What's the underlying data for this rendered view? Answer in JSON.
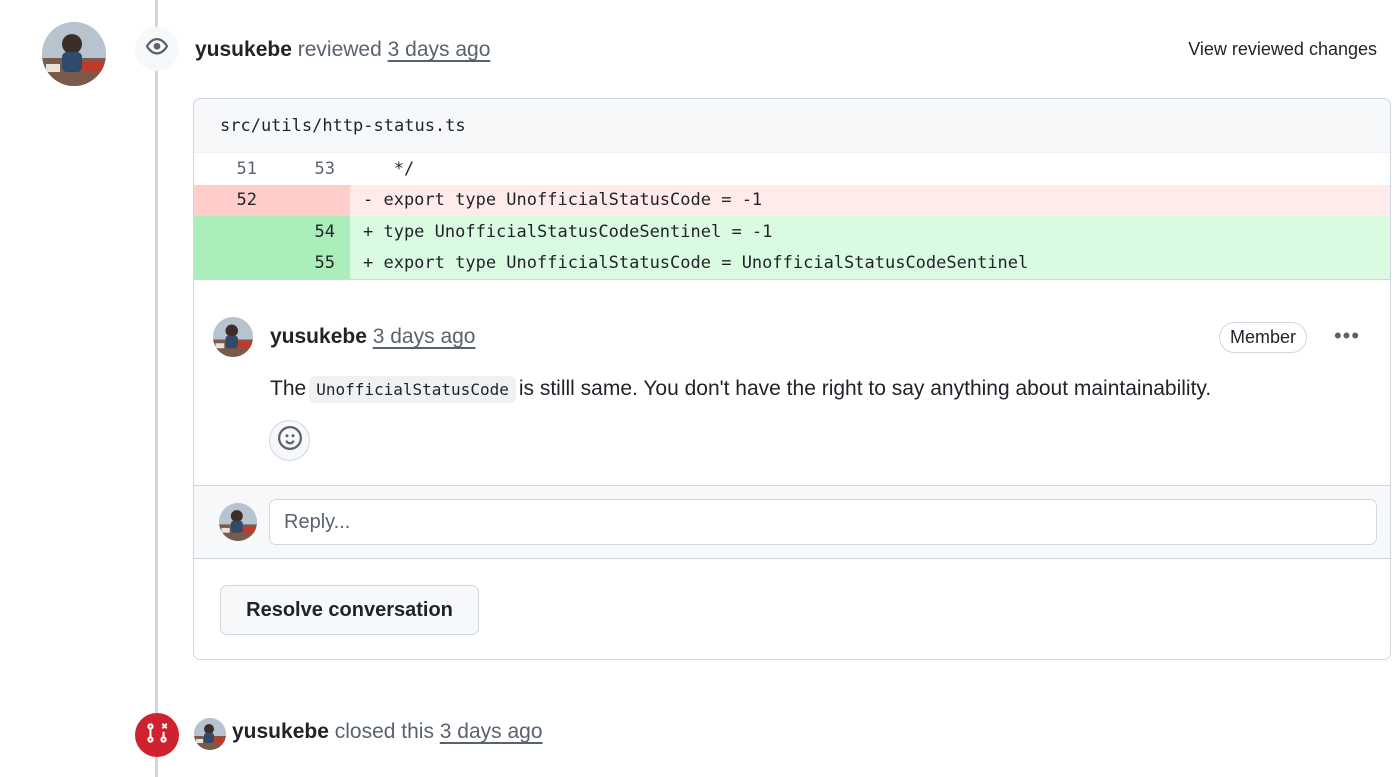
{
  "review": {
    "author": "yusukebe",
    "action": "reviewed",
    "time": "3 days ago",
    "view_changes_label": "View reviewed changes"
  },
  "diff": {
    "file_path": "src/utils/http-status.ts",
    "lines": [
      {
        "type": "ctx",
        "old": "51",
        "new": "53",
        "code": "   */"
      },
      {
        "type": "del",
        "old": "52",
        "new": "",
        "code": "- export type UnofficialStatusCode = -1"
      },
      {
        "type": "add",
        "old": "",
        "new": "54",
        "code": "+ type UnofficialStatusCodeSentinel = -1"
      },
      {
        "type": "add",
        "old": "",
        "new": "55",
        "code": "+ export type UnofficialStatusCode = UnofficialStatusCodeSentinel"
      }
    ]
  },
  "comment": {
    "author": "yusukebe",
    "time": "3 days ago",
    "badge": "Member",
    "menu_glyph": "•••",
    "body_before": "The",
    "body_code": "UnofficialStatusCode",
    "body_after": "is stilll same. You don't have the right to say anything about maintainability."
  },
  "reply": {
    "placeholder": "Reply..."
  },
  "resolve_label": "Resolve conversation",
  "closed_event": {
    "author": "yusukebe",
    "action": "closed this",
    "time": "3 days ago"
  },
  "colors": {
    "closed_badge": "#cf222e",
    "deletion_bg": "#ffebe9",
    "addition_bg": "#dafbe1"
  },
  "icons": [
    "eye-icon",
    "smiley-icon",
    "git-pull-request-closed-icon",
    "kebab-horizontal-icon"
  ]
}
